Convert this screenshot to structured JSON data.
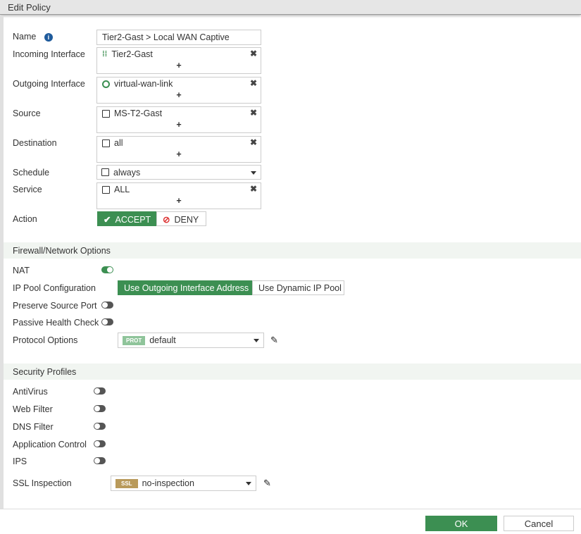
{
  "title": "Edit Policy",
  "policy": {
    "name_label": "Name",
    "name_value": "Tier2-Gast > Local WAN Captive",
    "incoming_label": "Incoming Interface",
    "incoming_value": "Tier2-Gast",
    "outgoing_label": "Outgoing Interface",
    "outgoing_value": "virtual-wan-link",
    "source_label": "Source",
    "source_value": "MS-T2-Gast",
    "destination_label": "Destination",
    "destination_value": "all",
    "schedule_label": "Schedule",
    "schedule_value": "always",
    "service_label": "Service",
    "service_value": "ALL",
    "action_label": "Action",
    "accept": "ACCEPT",
    "deny": "DENY",
    "plus": "+",
    "remove": "✖"
  },
  "firewall": {
    "header": "Firewall/Network Options",
    "nat_label": "NAT",
    "nat_on": true,
    "ippool_label": "IP Pool Configuration",
    "ippool_opt1": "Use Outgoing Interface Address",
    "ippool_opt2": "Use Dynamic IP Pool",
    "preserve_label": "Preserve Source Port",
    "passive_label": "Passive Health Check",
    "protocol_label": "Protocol Options",
    "protocol_tag": "PROT",
    "protocol_value": "default"
  },
  "security": {
    "header": "Security Profiles",
    "antivirus": "AntiVirus",
    "webfilter": "Web Filter",
    "dnsfilter": "DNS Filter",
    "appcontrol": "Application Control",
    "ips": "IPS",
    "ssl_label": "SSL Inspection",
    "ssl_tag": "SSL",
    "ssl_value": "no-inspection"
  },
  "footer": {
    "ok": "OK",
    "cancel": "Cancel"
  },
  "colors": {
    "accent": "#3c8f52",
    "ssl_tag": "#b99a5b",
    "prot_tag": "#8fc49a"
  }
}
